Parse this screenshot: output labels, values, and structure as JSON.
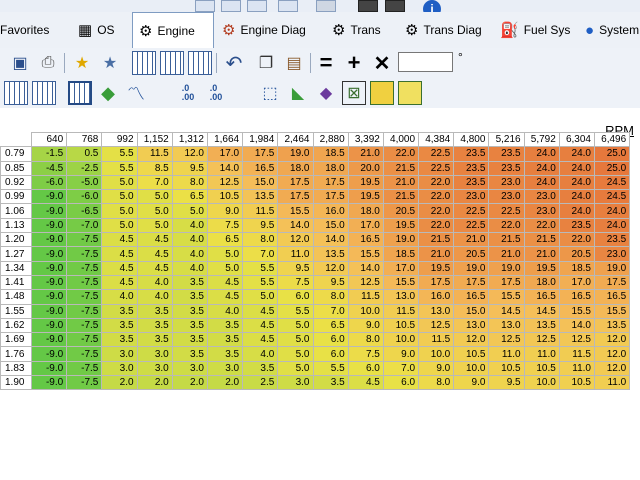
{
  "tabs": [
    {
      "label": "Favorites",
      "icon": "favorites-icon",
      "active": false
    },
    {
      "label": "OS",
      "icon": "chip-icon",
      "active": false
    },
    {
      "label": "Engine",
      "icon": "engine-icon",
      "active": true
    },
    {
      "label": "Engine Diag",
      "icon": "engine-diag-icon",
      "active": false
    },
    {
      "label": "Trans",
      "icon": "gear-icon",
      "active": false
    },
    {
      "label": "Trans Diag",
      "icon": "gear-diag-icon",
      "active": false
    },
    {
      "label": "Fuel Sys",
      "icon": "fuel-pump-icon",
      "active": false
    },
    {
      "label": "System",
      "icon": "globe-icon",
      "active": false
    }
  ],
  "toolbar": {
    "increment_value": "",
    "decimal_increase": ".0\n.00",
    "decimal_decrease": ".0\n.00",
    "unit_symbol": "°"
  },
  "table": {
    "axis_label": "RPM",
    "columns": [
      "640",
      "768",
      "992",
      "1,152",
      "1,312",
      "1,664",
      "1,984",
      "2,464",
      "2,880",
      "3,392",
      "4,000",
      "4,384",
      "4,800",
      "5,216",
      "5,792",
      "6,304",
      "6,496"
    ],
    "rows": [
      {
        "label": "0.79",
        "values": [
          "-1.5",
          "0.5",
          "5.5",
          "11.5",
          "12.0",
          "17.0",
          "17.5",
          "19.0",
          "18.5",
          "21.0",
          "22.0",
          "22.5",
          "23.5",
          "23.5",
          "24.0",
          "24.0",
          "25.0"
        ]
      },
      {
        "label": "0.85",
        "values": [
          "-4.5",
          "-2.5",
          "5.5",
          "8.5",
          "9.5",
          "14.0",
          "16.5",
          "18.0",
          "18.0",
          "20.0",
          "21.5",
          "22.5",
          "23.5",
          "23.5",
          "24.0",
          "24.0",
          "25.0"
        ]
      },
      {
        "label": "0.92",
        "values": [
          "-6.0",
          "-5.0",
          "5.0",
          "7.0",
          "8.0",
          "12.5",
          "15.0",
          "17.5",
          "17.5",
          "19.5",
          "21.0",
          "22.0",
          "23.5",
          "23.0",
          "24.0",
          "24.0",
          "24.5"
        ]
      },
      {
        "label": "0.99",
        "values": [
          "-9.0",
          "-6.0",
          "5.0",
          "5.0",
          "6.5",
          "10.5",
          "13.5",
          "17.5",
          "17.5",
          "19.5",
          "21.5",
          "22.0",
          "23.0",
          "23.0",
          "23.0",
          "24.0",
          "24.5"
        ]
      },
      {
        "label": "1.06",
        "values": [
          "-9.0",
          "-6.5",
          "5.0",
          "5.0",
          "5.0",
          "9.0",
          "11.5",
          "15.5",
          "16.0",
          "18.0",
          "20.5",
          "22.0",
          "22.5",
          "22.5",
          "23.0",
          "24.0",
          "24.0"
        ]
      },
      {
        "label": "1.13",
        "values": [
          "-9.0",
          "-7.0",
          "5.0",
          "5.0",
          "4.0",
          "7.5",
          "9.5",
          "14.0",
          "15.0",
          "17.0",
          "19.5",
          "22.0",
          "22.5",
          "22.0",
          "22.0",
          "23.5",
          "24.0"
        ]
      },
      {
        "label": "1.20",
        "values": [
          "-9.0",
          "-7.5",
          "4.5",
          "4.5",
          "4.0",
          "6.5",
          "8.0",
          "12.0",
          "14.0",
          "16.5",
          "19.0",
          "21.5",
          "21.0",
          "21.5",
          "21.5",
          "22.0",
          "23.5"
        ]
      },
      {
        "label": "1.27",
        "values": [
          "-9.0",
          "-7.5",
          "4.5",
          "4.5",
          "4.0",
          "5.0",
          "7.0",
          "11.0",
          "13.5",
          "15.5",
          "18.5",
          "21.0",
          "20.5",
          "21.0",
          "21.0",
          "20.5",
          "23.0"
        ]
      },
      {
        "label": "1.34",
        "values": [
          "-9.0",
          "-7.5",
          "4.5",
          "4.5",
          "4.0",
          "5.0",
          "5.5",
          "9.5",
          "12.0",
          "14.0",
          "17.0",
          "19.5",
          "19.0",
          "19.0",
          "19.5",
          "18.5",
          "19.0"
        ]
      },
      {
        "label": "1.41",
        "values": [
          "-9.0",
          "-7.5",
          "4.5",
          "4.0",
          "3.5",
          "4.5",
          "5.5",
          "7.5",
          "9.5",
          "12.5",
          "15.5",
          "17.5",
          "17.5",
          "17.5",
          "18.0",
          "17.0",
          "17.5"
        ]
      },
      {
        "label": "1.48",
        "values": [
          "-9.0",
          "-7.5",
          "4.0",
          "4.0",
          "3.5",
          "4.5",
          "5.0",
          "6.0",
          "8.0",
          "11.5",
          "13.0",
          "16.0",
          "16.5",
          "15.5",
          "16.5",
          "16.5",
          "16.5"
        ]
      },
      {
        "label": "1.55",
        "values": [
          "-9.0",
          "-7.5",
          "3.5",
          "3.5",
          "3.5",
          "4.0",
          "4.5",
          "5.5",
          "7.0",
          "10.0",
          "11.5",
          "13.0",
          "15.0",
          "14.5",
          "14.5",
          "15.5",
          "15.5"
        ]
      },
      {
        "label": "1.62",
        "values": [
          "-9.0",
          "-7.5",
          "3.5",
          "3.5",
          "3.5",
          "3.5",
          "4.5",
          "5.0",
          "6.5",
          "9.0",
          "10.5",
          "12.5",
          "13.0",
          "13.0",
          "13.5",
          "14.0",
          "13.5"
        ]
      },
      {
        "label": "1.69",
        "values": [
          "-9.0",
          "-7.5",
          "3.5",
          "3.5",
          "3.5",
          "3.5",
          "4.5",
          "5.0",
          "6.0",
          "8.0",
          "10.0",
          "11.5",
          "12.0",
          "12.5",
          "12.5",
          "12.5",
          "12.0"
        ]
      },
      {
        "label": "1.76",
        "values": [
          "-9.0",
          "-7.5",
          "3.0",
          "3.0",
          "3.5",
          "3.5",
          "4.0",
          "5.0",
          "6.0",
          "7.5",
          "9.0",
          "10.0",
          "10.5",
          "11.0",
          "11.0",
          "11.5",
          "12.0"
        ]
      },
      {
        "label": "1.83",
        "values": [
          "-9.0",
          "-7.5",
          "3.0",
          "3.0",
          "3.0",
          "3.0",
          "3.5",
          "5.0",
          "5.5",
          "6.0",
          "7.0",
          "9.0",
          "10.0",
          "10.5",
          "10.5",
          "11.0",
          "12.0"
        ]
      },
      {
        "label": "1.90",
        "values": [
          "-9.0",
          "-7.5",
          "2.0",
          "2.0",
          "2.0",
          "2.0",
          "2.5",
          "3.0",
          "3.5",
          "4.5",
          "6.0",
          "8.0",
          "9.0",
          "9.5",
          "10.0",
          "10.5",
          "11.0"
        ]
      }
    ]
  }
}
